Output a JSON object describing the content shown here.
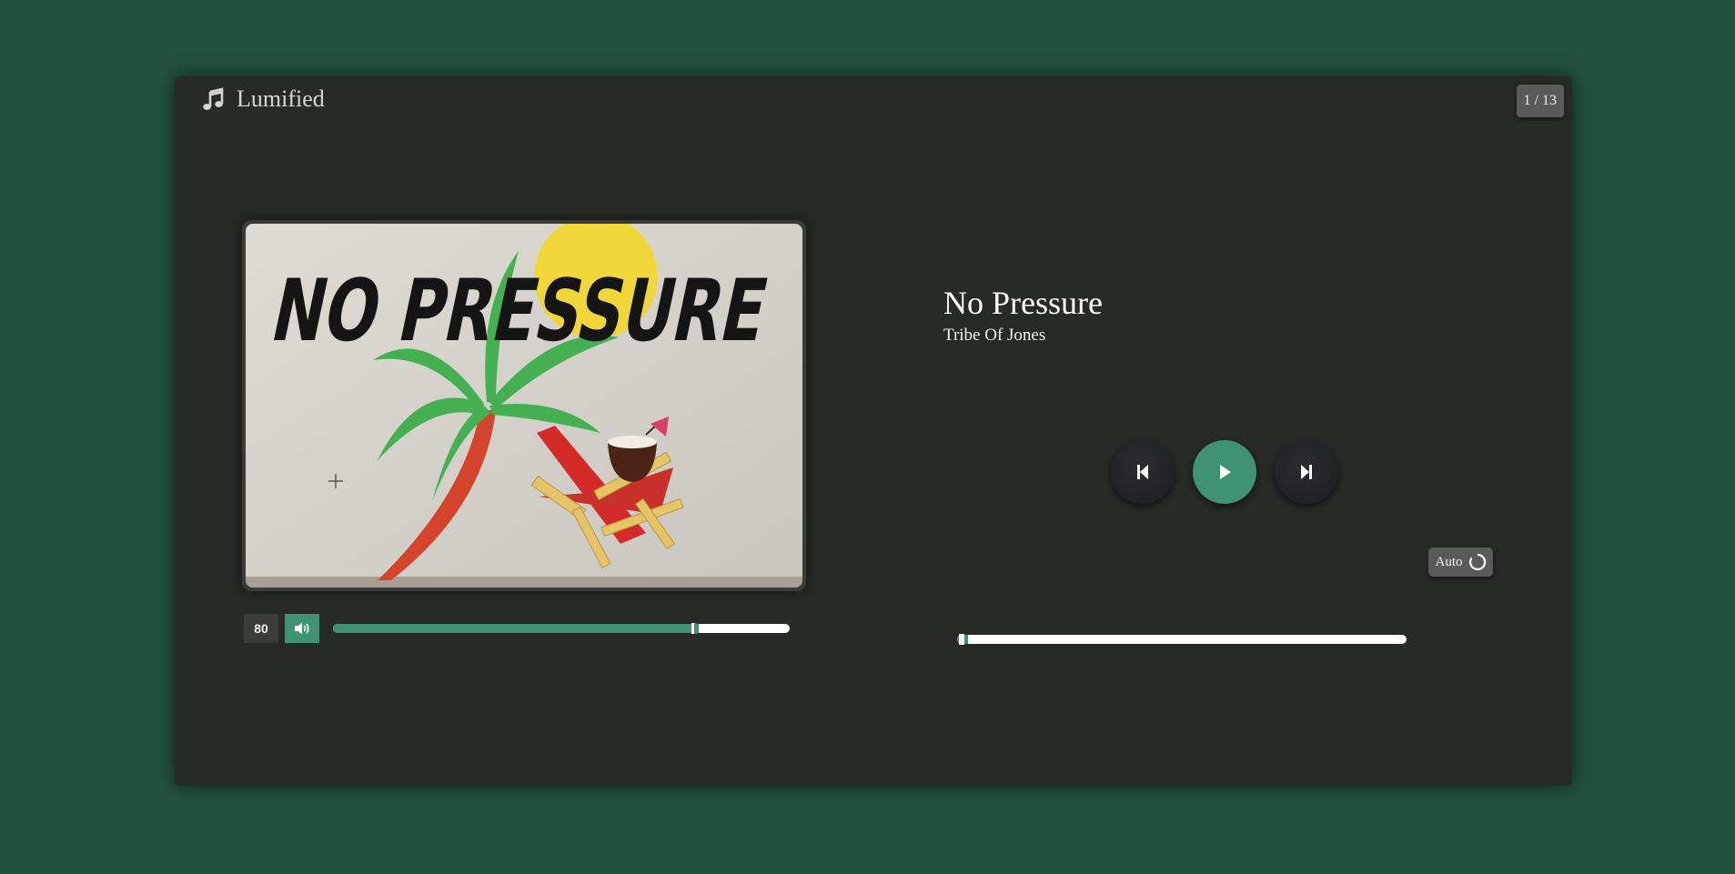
{
  "app": {
    "name": "Lumified",
    "icon": "music-note-icon",
    "background_color": "#22523d",
    "accent_color": "#3f9272"
  },
  "playlist": {
    "position": "1 / 13"
  },
  "track": {
    "title": "No Pressure",
    "artist": "Tribe Of Jones",
    "album_art_text": "NO PRESSURE",
    "progress_fraction": 0.02
  },
  "volume": {
    "value": "80",
    "level_fraction": 0.8,
    "icon": "speaker-volume-icon"
  },
  "controls": {
    "previous_icon": "skip-previous-icon",
    "play_icon": "play-icon",
    "next_icon": "skip-next-icon"
  },
  "autoplay": {
    "label": "Auto",
    "icon": "repeat-circle-icon"
  }
}
